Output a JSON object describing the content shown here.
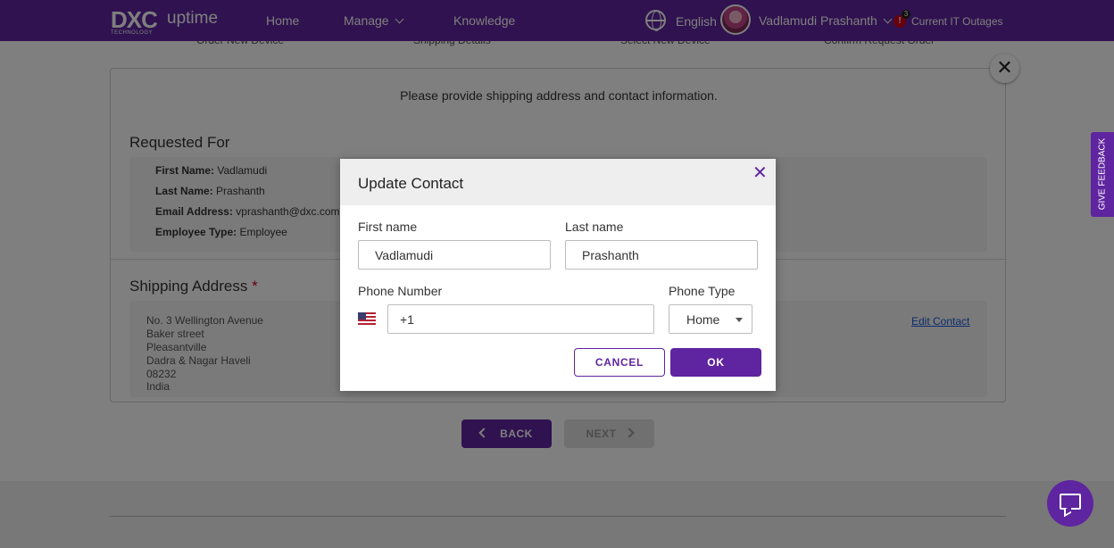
{
  "navbar": {
    "logo_brand": "DXC",
    "logo_sub": "TECHNOLOGY",
    "logo_product": "uptime",
    "home": "Home",
    "manage": "Manage",
    "knowledge": "Knowledge",
    "language": "English",
    "user": "Vadlamudi Prashanth",
    "outage_count": "3",
    "outage_label": "Current IT Outages"
  },
  "stepper": [
    "Order New Device",
    "Shipping Details",
    "Select New Device",
    "Confirm Request Order"
  ],
  "card": {
    "intro": "Please provide shipping address and contact information.",
    "requested_title": "Requested For",
    "fields": [
      {
        "label": "First Name:",
        "value": "Vadlamudi"
      },
      {
        "label": "Last Name:",
        "value": "Prashanth"
      },
      {
        "label": "Email Address:",
        "value": "vprashanth@dxc.com"
      },
      {
        "label": "Employee Type:",
        "value": "Employee"
      }
    ],
    "shipping_title": "Shipping Address",
    "required_mark": "*",
    "address": [
      "No. 3 Wellington Avenue",
      "Baker street",
      "Pleasantville",
      "Dadra & Nagar Haveli",
      "08232",
      "India"
    ],
    "edit_contact": "Edit Contact",
    "close": "✕"
  },
  "nav_buttons": {
    "back": "BACK",
    "next": "NEXT"
  },
  "feedback": "GIVE FEEDBACK",
  "modal": {
    "title": "Update Contact",
    "close": "✕",
    "first_name_label": "First name",
    "first_name_value": "Vadlamudi",
    "last_name_label": "Last name",
    "last_name_value": "Prashanth",
    "phone_label": "Phone Number",
    "phone_value": "+1",
    "phone_type_label": "Phone Type",
    "phone_type_value": "Home",
    "cancel": "CANCEL",
    "ok": "OK"
  },
  "colors": {
    "brand": "#5f249f",
    "alert": "#d0021b",
    "link": "#1a56db"
  }
}
